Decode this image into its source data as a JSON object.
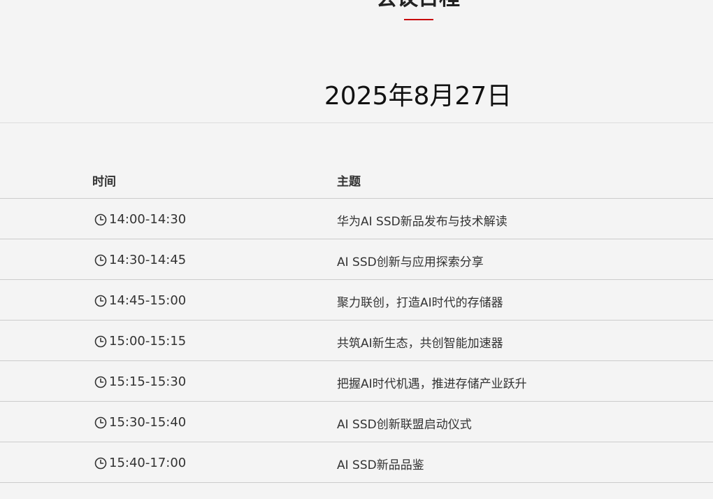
{
  "section": {
    "title": "会议日程"
  },
  "date_heading": "2025年8月27日",
  "schedule": {
    "headers": {
      "time": "时间",
      "topic": "主题"
    },
    "rows": [
      {
        "time": "14:00-14:30",
        "topic": "华为AI SSD新品发布与技术解读"
      },
      {
        "time": "14:30-14:45",
        "topic": "AI SSD创新与应用探索分享"
      },
      {
        "time": "14:45-15:00",
        "topic": "聚力联创，打造AI时代的存储器"
      },
      {
        "time": "15:00-15:15",
        "topic": "共筑AI新生态，共创智能加速器"
      },
      {
        "time": "15:15-15:30",
        "topic": "把握AI时代机遇，推进存储产业跃升"
      },
      {
        "time": "15:30-15:40",
        "topic": "AI SSD创新联盟启动仪式"
      },
      {
        "time": "15:40-17:00",
        "topic": "AI SSD新品品鉴"
      }
    ]
  },
  "colors": {
    "accent": "#c7000b",
    "background": "#f4f4f4",
    "divider": "#cccccc"
  },
  "icons": {
    "time": "clock-icon"
  }
}
